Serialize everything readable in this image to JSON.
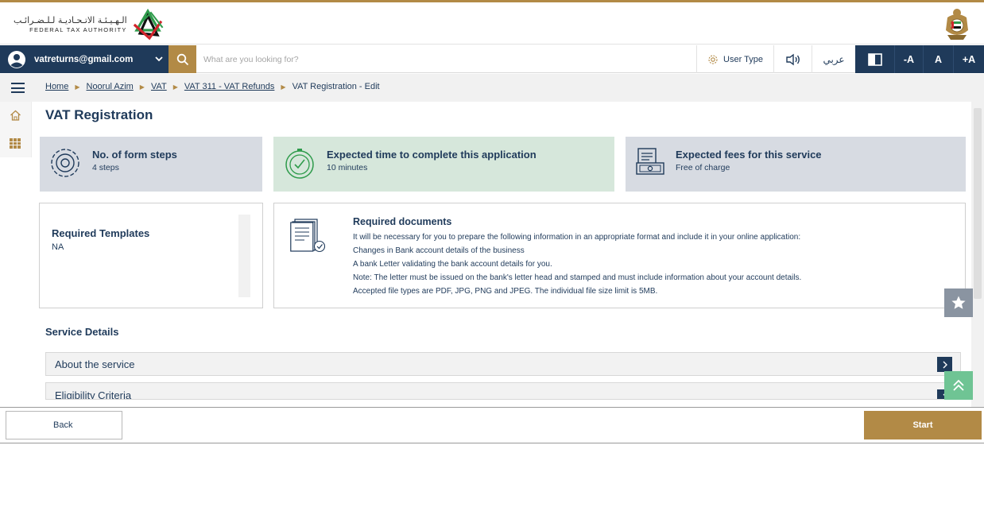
{
  "header": {
    "logo_arabic": "الـهـيـئـة الاتـحـاديـة لـلـضـرائـب",
    "logo_english": "FEDERAL TAX AUTHORITY",
    "logo_icon": "fta-logo",
    "emblem_icon": "uae-emblem"
  },
  "toolbar": {
    "user_email": "vatreturns@gmail.com",
    "search_placeholder": "What are you looking for?",
    "user_type_label": "User Type",
    "language_label": "عربي",
    "font_decrease": "-A",
    "font_reset": "A",
    "font_increase": "+A",
    "colors": {
      "navy": "#1f3a5a",
      "gold": "#b28a46"
    }
  },
  "breadcrumb": {
    "items": [
      "Home",
      "Noorul Azim",
      "VAT",
      "VAT 311 - VAT Refunds"
    ],
    "current": "VAT Registration - Edit"
  },
  "page": {
    "title": "VAT Registration"
  },
  "cards": {
    "steps": {
      "title": "No. of form steps",
      "value": "4 steps",
      "icon": "gear-icon"
    },
    "time": {
      "title": "Expected time to complete this application",
      "value": "10 minutes",
      "icon": "stopwatch-icon"
    },
    "fees": {
      "title": "Expected fees for this service",
      "value": "Free of charge",
      "icon": "money-icon"
    }
  },
  "templates": {
    "title": "Required Templates",
    "value": "NA"
  },
  "documents": {
    "title": "Required documents",
    "lines": [
      "It will be necessary for you to prepare the following information in an appropriate format and include it in your online application:",
      "Changes in Bank account details of the business",
      "A bank Letter validating the bank account details for you.",
      "Note: The letter must be issued on the bank's letter head and stamped and must include information about your account details.",
      "Accepted file types are PDF, JPG, PNG and JPEG. The individual file size limit is 5MB."
    ]
  },
  "service_details": {
    "title": "Service Details",
    "sections": [
      "About the service",
      "Eligibility Criteria"
    ]
  },
  "footer": {
    "back_label": "Back",
    "start_label": "Start"
  }
}
